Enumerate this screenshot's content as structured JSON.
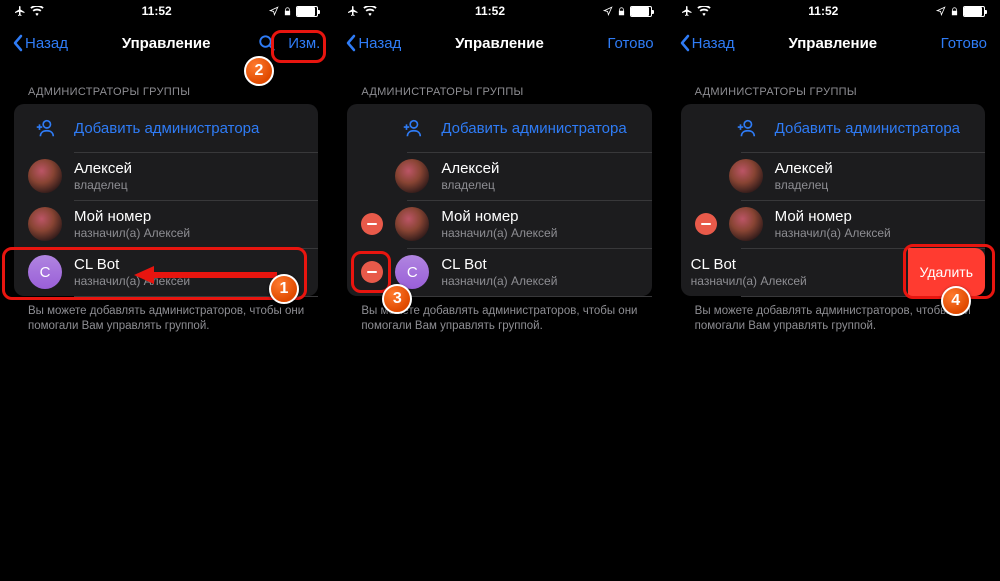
{
  "status": {
    "time": "11:52"
  },
  "nav": {
    "back": "Назад",
    "title": "Управление",
    "edit": "Изм.",
    "done": "Готово"
  },
  "section": {
    "header": "АДМИНИСТРАТОРЫ ГРУППЫ"
  },
  "addAdmin": "Добавить администратора",
  "admins": [
    {
      "name": "Алексей",
      "sub": "владелец",
      "avatar": "redpanda"
    },
    {
      "name": "Мой номер",
      "sub": "назначил(а) Алексей",
      "avatar": "redpanda"
    },
    {
      "name": "CL Bot",
      "sub": "назначил(а) Алексей",
      "avatar": "purple",
      "initial": "C"
    }
  ],
  "footer": "Вы можете добавлять администраторов, чтобы они помогали Вам управлять группой.",
  "deleteLabel": "Удалить"
}
